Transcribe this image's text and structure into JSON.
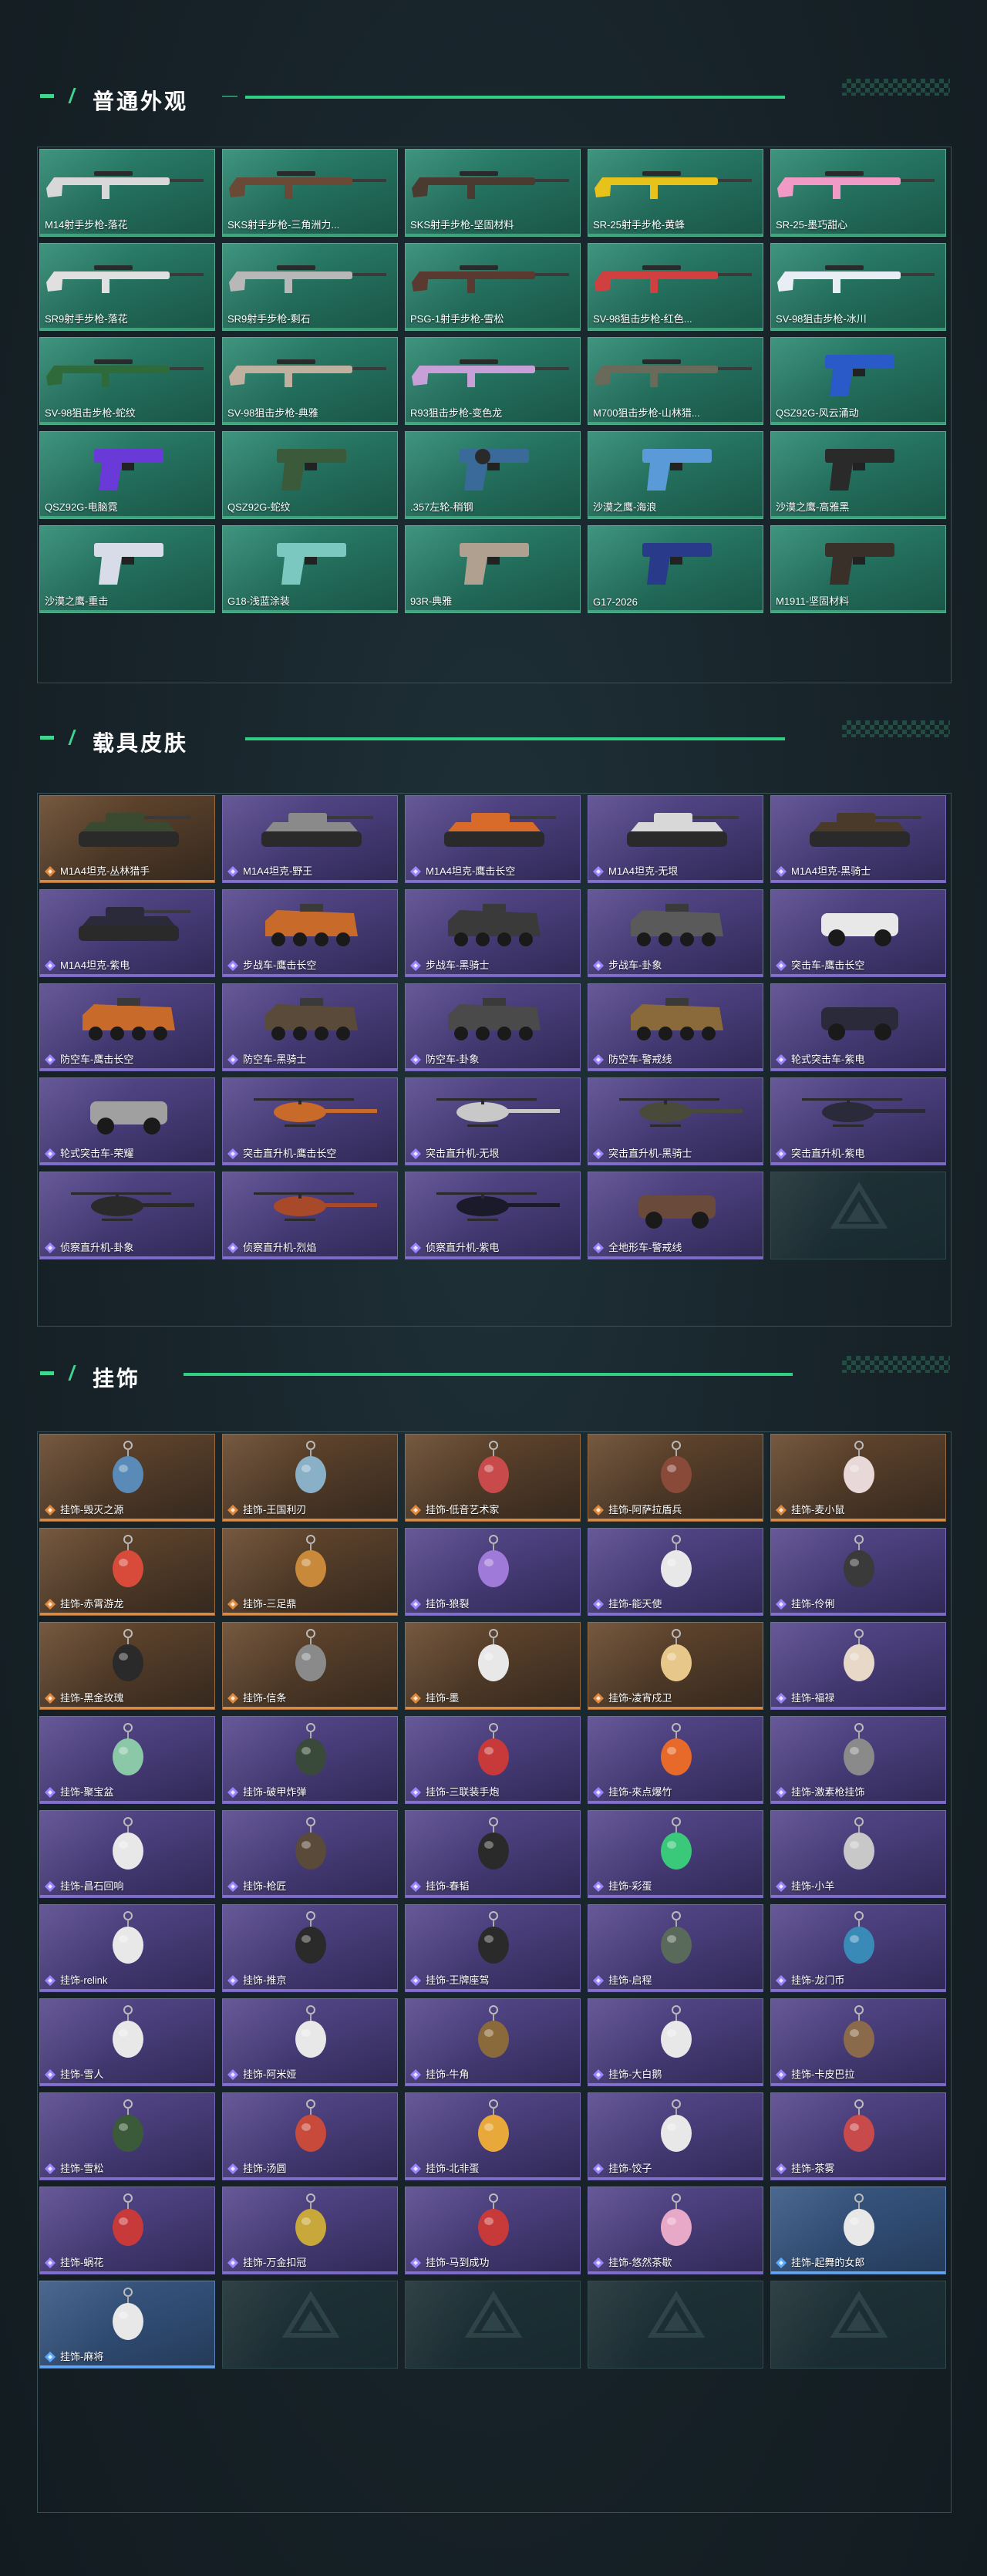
{
  "sections": {
    "weapons": {
      "title": "普通外观"
    },
    "vehicles": {
      "title": "载具皮肤"
    },
    "charms": {
      "title": "挂饰"
    }
  },
  "colors": {
    "accent": "#3fd68f",
    "rarity_orange": "#e0893b",
    "rarity_purple": "#9d84ff",
    "rarity_blue": "#58a8ff"
  },
  "weapons": [
    {
      "label": "M14射手步枪-落花",
      "icon": "rifle-icon",
      "color": "#d8d8d8"
    },
    {
      "label": "SKS射手步枪-三角洲力...",
      "icon": "rifle-icon",
      "color": "#6a4a36"
    },
    {
      "label": "SKS射手步枪-坚固材料",
      "icon": "rifle-icon",
      "color": "#4a3a30"
    },
    {
      "label": "SR-25射手步枪-黄蜂",
      "icon": "rifle-icon",
      "color": "#e6c21a"
    },
    {
      "label": "SR-25-墨巧甜心",
      "icon": "rifle-icon",
      "color": "#f19ac5"
    },
    {
      "label": "SR9射手步枪-落花",
      "icon": "rifle-icon",
      "color": "#e0e0e0"
    },
    {
      "label": "SR9射手步枪-剩石",
      "icon": "rifle-icon",
      "color": "#b8b8b8"
    },
    {
      "label": "PSG-1射手步枪-雪松",
      "icon": "rifle-icon",
      "color": "#5a3a30"
    },
    {
      "label": "SV-98狙击步枪-红色...",
      "icon": "rifle-icon",
      "color": "#d04040"
    },
    {
      "label": "SV-98狙击步枪-冰川",
      "icon": "rifle-icon",
      "color": "#e8eef5"
    },
    {
      "label": "SV-98狙击步枪-蛇纹",
      "icon": "rifle-icon",
      "color": "#2f6a3a"
    },
    {
      "label": "SV-98狙击步枪-典雅",
      "icon": "rifle-icon",
      "color": "#c0b0a0"
    },
    {
      "label": "R93狙击步枪-变色龙",
      "icon": "rifle-icon",
      "color": "#c8a0d8"
    },
    {
      "label": "M700狙击步枪-山林猎...",
      "icon": "rifle-icon",
      "color": "#6a6a5a"
    },
    {
      "label": "QSZ92G-风云涌动",
      "icon": "pistol-icon",
      "color": "#2a5ac8"
    },
    {
      "label": "QSZ92G-电脑霓",
      "icon": "pistol-icon",
      "color": "#6a3ad8"
    },
    {
      "label": "QSZ92G-蛇纹",
      "icon": "pistol-icon",
      "color": "#3a5a3a"
    },
    {
      "label": ".357左轮-稍钢",
      "icon": "revolver-icon",
      "color": "#3a6a9a"
    },
    {
      "label": "沙漠之鹰-海浪",
      "icon": "pistol-icon",
      "color": "#5a9ad8"
    },
    {
      "label": "沙漠之鹰-高雅黑",
      "icon": "pistol-icon",
      "color": "#2a2a2a"
    },
    {
      "label": "沙漠之鹰-重击",
      "icon": "pistol-icon",
      "color": "#d8dce8"
    },
    {
      "label": "G18-浅蓝涂装",
      "icon": "pistol-icon",
      "color": "#7ac8c0"
    },
    {
      "label": "93R-典雅",
      "icon": "pistol-icon",
      "color": "#b0a090"
    },
    {
      "label": "G17-2026",
      "icon": "pistol-icon",
      "color": "#2a3a8a"
    },
    {
      "label": "M1911-坚固材料",
      "icon": "pistol-icon",
      "color": "#3a302a"
    }
  ],
  "vehicles": [
    {
      "label": "M1A4坦克-丛林猎手",
      "rarity": "orange",
      "icon": "tank-icon",
      "color": "#3a4a30"
    },
    {
      "label": "M1A4坦克-野王",
      "rarity": "purple",
      "icon": "tank-icon",
      "color": "#8a8a8a"
    },
    {
      "label": "M1A4坦克-鹰击长空",
      "rarity": "purple",
      "icon": "tank-icon",
      "color": "#d86a2a"
    },
    {
      "label": "M1A4坦克-无垠",
      "rarity": "purple",
      "icon": "tank-icon",
      "color": "#d8d8d8"
    },
    {
      "label": "M1A4坦克-黑骑士",
      "rarity": "purple",
      "icon": "tank-icon",
      "color": "#4a3a2a"
    },
    {
      "label": "M1A4坦克-紫电",
      "rarity": "purple",
      "icon": "tank-icon",
      "color": "#2a2a3a"
    },
    {
      "label": "步战车-鹰击长空",
      "rarity": "purple",
      "icon": "apc-icon",
      "color": "#c86a2a"
    },
    {
      "label": "步战车-黑骑士",
      "rarity": "purple",
      "icon": "apc-icon",
      "color": "#3a3a3a"
    },
    {
      "label": "步战车-卦象",
      "rarity": "purple",
      "icon": "apc-icon",
      "color": "#5a5a5a"
    },
    {
      "label": "突击车-鹰击长空",
      "rarity": "purple",
      "icon": "jeep-icon",
      "color": "#e8e8e8"
    },
    {
      "label": "防空车-鹰击长空",
      "rarity": "purple",
      "icon": "apc-icon",
      "color": "#c86a2a"
    },
    {
      "label": "防空车-黑骑士",
      "rarity": "purple",
      "icon": "apc-icon",
      "color": "#5a4a3a"
    },
    {
      "label": "防空车-卦象",
      "rarity": "purple",
      "icon": "apc-icon",
      "color": "#4a4a4a"
    },
    {
      "label": "防空车-警戒线",
      "rarity": "purple",
      "icon": "apc-icon",
      "color": "#8a6a3a"
    },
    {
      "label": "轮式突击车-紫电",
      "rarity": "purple",
      "icon": "jeep-icon",
      "color": "#2a2a3a"
    },
    {
      "label": "轮式突击车-荣耀",
      "rarity": "purple",
      "icon": "buggy-icon",
      "color": "#a0a0a0"
    },
    {
      "label": "突击直升机-鹰击长空",
      "rarity": "purple",
      "icon": "helicopter-icon",
      "color": "#c86a2a"
    },
    {
      "label": "突击直升机-无垠",
      "rarity": "purple",
      "icon": "helicopter-icon",
      "color": "#c8c8c8"
    },
    {
      "label": "突击直升机-黑骑士",
      "rarity": "purple",
      "icon": "helicopter-icon",
      "color": "#4a4a3a"
    },
    {
      "label": "突击直升机-紫电",
      "rarity": "purple",
      "icon": "helicopter-icon",
      "color": "#2a2a3a"
    },
    {
      "label": "侦察直升机-卦象",
      "rarity": "purple",
      "icon": "helicopter-icon",
      "color": "#2a2a2a"
    },
    {
      "label": "侦察直升机-烈焰",
      "rarity": "purple",
      "icon": "helicopter-icon",
      "color": "#a84a2a"
    },
    {
      "label": "侦察直升机-紫电",
      "rarity": "purple",
      "icon": "helicopter-icon",
      "color": "#1a1a2a"
    },
    {
      "label": "全地形车-警戒线",
      "rarity": "purple",
      "icon": "atv-icon",
      "color": "#6a4a3a"
    },
    {
      "label": "",
      "rarity": "empty",
      "icon": "delta-logo-icon",
      "color": ""
    }
  ],
  "charms": [
    {
      "label": "挂饰-毁灭之源",
      "rarity": "orange",
      "icon": "charm-icon",
      "color": "#5a8ab8"
    },
    {
      "label": "挂饰-王国利刃",
      "rarity": "orange",
      "icon": "charm-icon",
      "color": "#8ab0c8"
    },
    {
      "label": "挂饰-低音艺术家",
      "rarity": "orange",
      "icon": "charm-icon",
      "color": "#c84a4a"
    },
    {
      "label": "挂饰-阿萨拉盾兵",
      "rarity": "orange",
      "icon": "charm-icon",
      "color": "#8a4a3a"
    },
    {
      "label": "挂饰-麦小鼠",
      "rarity": "orange",
      "icon": "charm-icon",
      "color": "#e8d8d8"
    },
    {
      "label": "挂饰-赤霄游龙",
      "rarity": "orange",
      "icon": "charm-icon",
      "color": "#d84a3a"
    },
    {
      "label": "挂饰-三足鼎",
      "rarity": "orange",
      "icon": "charm-icon",
      "color": "#c88a3a"
    },
    {
      "label": "挂饰-狼裂",
      "rarity": "purple",
      "icon": "charm-icon",
      "color": "#a07ad8"
    },
    {
      "label": "挂饰-能天使",
      "rarity": "purple",
      "icon": "charm-icon",
      "color": "#e8e8e8"
    },
    {
      "label": "挂饰-伶俐",
      "rarity": "purple",
      "icon": "charm-icon",
      "color": "#3a3a3a"
    },
    {
      "label": "挂饰-黑金玫瑰",
      "rarity": "orange",
      "icon": "charm-icon",
      "color": "#2a2a2a"
    },
    {
      "label": "挂饰-信条",
      "rarity": "orange",
      "icon": "charm-icon",
      "color": "#8a8a8a"
    },
    {
      "label": "挂饰-墨",
      "rarity": "orange",
      "icon": "charm-icon",
      "color": "#e8e8e8"
    },
    {
      "label": "挂饰-凌宵戍卫",
      "rarity": "orange",
      "icon": "charm-icon",
      "color": "#e8c88a"
    },
    {
      "label": "挂饰-福禄",
      "rarity": "purple",
      "icon": "charm-icon",
      "color": "#e8d8c8"
    },
    {
      "label": "挂饰-聚宝盆",
      "rarity": "purple",
      "icon": "charm-icon",
      "color": "#8ac8a8"
    },
    {
      "label": "挂饰-破甲炸弹",
      "rarity": "purple",
      "icon": "charm-icon",
      "color": "#3a4a3a"
    },
    {
      "label": "挂饰-三联装手炮",
      "rarity": "purple",
      "icon": "charm-icon",
      "color": "#c83a3a"
    },
    {
      "label": "挂饰-來点爆竹",
      "rarity": "purple",
      "icon": "charm-icon",
      "color": "#e86a2a"
    },
    {
      "label": "挂饰-激素枪挂饰",
      "rarity": "purple",
      "icon": "charm-icon",
      "color": "#8a8a8a"
    },
    {
      "label": "挂饰-昌石回响",
      "rarity": "purple",
      "icon": "charm-icon",
      "color": "#e8e8e8"
    },
    {
      "label": "挂饰-枪匠",
      "rarity": "purple",
      "icon": "charm-icon",
      "color": "#5a4a3a"
    },
    {
      "label": "挂饰-春韬",
      "rarity": "purple",
      "icon": "charm-icon",
      "color": "#2a2a2a"
    },
    {
      "label": "挂饰-彩蛋",
      "rarity": "purple",
      "icon": "charm-icon",
      "color": "#3ac87a"
    },
    {
      "label": "挂饰-小羊",
      "rarity": "purple",
      "icon": "charm-icon",
      "color": "#c8c8c8"
    },
    {
      "label": "挂饰-relink",
      "rarity": "purple",
      "icon": "charm-icon",
      "color": "#e8e8e8"
    },
    {
      "label": "挂饰-推京",
      "rarity": "purple",
      "icon": "charm-icon",
      "color": "#2a2a2a"
    },
    {
      "label": "挂饰-王牌座驾",
      "rarity": "purple",
      "icon": "charm-icon",
      "color": "#2a2a2a"
    },
    {
      "label": "挂饰-启程",
      "rarity": "purple",
      "icon": "charm-icon",
      "color": "#5a6a5a"
    },
    {
      "label": "挂饰-龙门币",
      "rarity": "purple",
      "icon": "charm-icon",
      "color": "#3a8ab8"
    },
    {
      "label": "挂饰-雪人",
      "rarity": "purple",
      "icon": "charm-icon",
      "color": "#e8e8e8"
    },
    {
      "label": "挂饰-阿米娅",
      "rarity": "purple",
      "icon": "charm-icon",
      "color": "#e8e8e8"
    },
    {
      "label": "挂饰-牛角",
      "rarity": "purple",
      "icon": "charm-icon",
      "color": "#8a6a3a"
    },
    {
      "label": "挂饰-大白鹅",
      "rarity": "purple",
      "icon": "charm-icon",
      "color": "#e8e8e8"
    },
    {
      "label": "挂饰-卡皮巴拉",
      "rarity": "purple",
      "icon": "charm-icon",
      "color": "#8a6a4a"
    },
    {
      "label": "挂饰-雪松",
      "rarity": "purple",
      "icon": "charm-icon",
      "color": "#3a5a3a"
    },
    {
      "label": "挂饰-汤圆",
      "rarity": "purple",
      "icon": "charm-icon",
      "color": "#c84a3a"
    },
    {
      "label": "挂饰-北非蛋",
      "rarity": "purple",
      "icon": "charm-icon",
      "color": "#e8a83a"
    },
    {
      "label": "挂饰-饺子",
      "rarity": "purple",
      "icon": "charm-icon",
      "color": "#e8e8e8"
    },
    {
      "label": "挂饰-茶雾",
      "rarity": "purple",
      "icon": "charm-icon",
      "color": "#c84a4a"
    },
    {
      "label": "挂饰-蜗花",
      "rarity": "purple",
      "icon": "charm-icon",
      "color": "#c83a3a"
    },
    {
      "label": "挂饰-万金扣冠",
      "rarity": "purple",
      "icon": "charm-icon",
      "color": "#c8a83a"
    },
    {
      "label": "挂饰-马到成功",
      "rarity": "purple",
      "icon": "charm-icon",
      "color": "#c83a3a"
    },
    {
      "label": "挂饰-悠然茶歇",
      "rarity": "purple",
      "icon": "charm-icon",
      "color": "#e8a8c8"
    },
    {
      "label": "挂饰-起舞的女郎",
      "rarity": "blue",
      "icon": "charm-icon",
      "color": "#e8e8e8"
    },
    {
      "label": "挂饰-麻将",
      "rarity": "blue",
      "icon": "charm-icon",
      "color": "#e8e8e8"
    },
    {
      "label": "",
      "rarity": "empty",
      "icon": "delta-logo-icon",
      "color": ""
    },
    {
      "label": "",
      "rarity": "empty",
      "icon": "delta-logo-icon",
      "color": ""
    },
    {
      "label": "",
      "rarity": "empty",
      "icon": "delta-logo-icon",
      "color": ""
    },
    {
      "label": "",
      "rarity": "empty",
      "icon": "delta-logo-icon",
      "color": ""
    }
  ]
}
